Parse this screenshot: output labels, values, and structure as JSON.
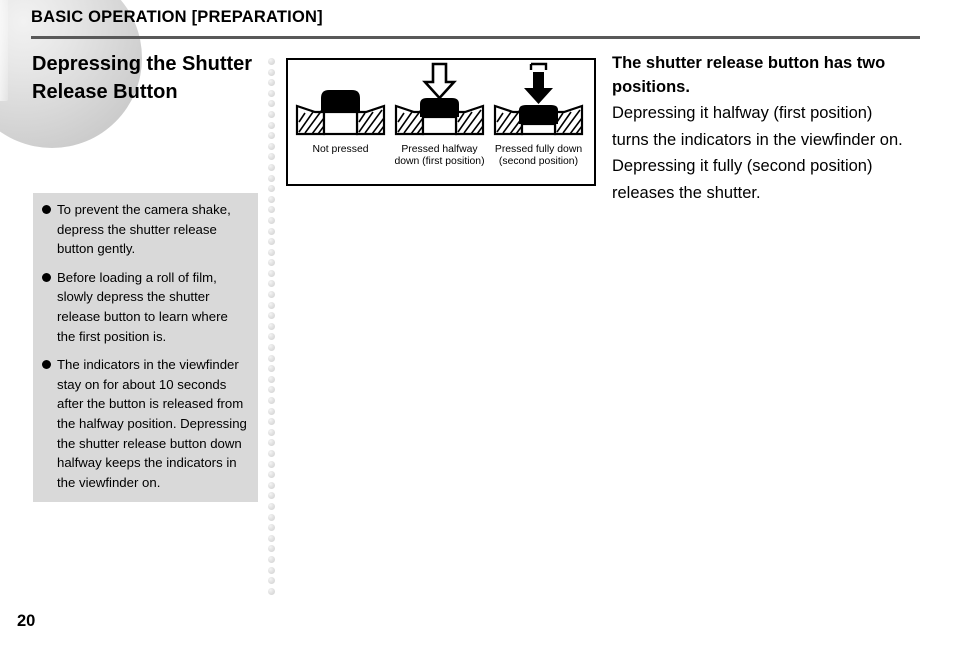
{
  "header": {
    "title": "BASIC OPERATION [PREPARATION]"
  },
  "section": {
    "title": "Depressing the Shutter Release Button"
  },
  "notes": {
    "items": [
      "To prevent the camera shake, depress the shutter release button gently.",
      "Before loading a roll of film, slowly depress the shutter release button to learn where the first position is.",
      "The indicators in the viewfinder stay on for about 10 seconds after the button is released from the halfway position. Depressing the shutter release button down halfway keeps the indicators in the viewfinder on."
    ]
  },
  "figure": {
    "panels": [
      {
        "caption": "Not pressed",
        "state": "unpressed",
        "arrow": "none"
      },
      {
        "caption": "Pressed halfway down (first position)",
        "state": "halfway",
        "arrow": "hollow-down-arrow"
      },
      {
        "caption": "Pressed fully down (second position)",
        "state": "fully",
        "arrow": "solid-down-arrow"
      }
    ]
  },
  "right": {
    "heading": "The shutter release button has two positions.",
    "body": "Depressing it halfway (first position) turns the indicators in the viewfinder on. Depressing it fully (second position) releases the shutter."
  },
  "footer": {
    "page_number": "20"
  },
  "colors": {
    "rule": "#595959",
    "panel_bg": "#d9d9d9",
    "ink": "#000000",
    "page_bg": "#ffffff"
  }
}
